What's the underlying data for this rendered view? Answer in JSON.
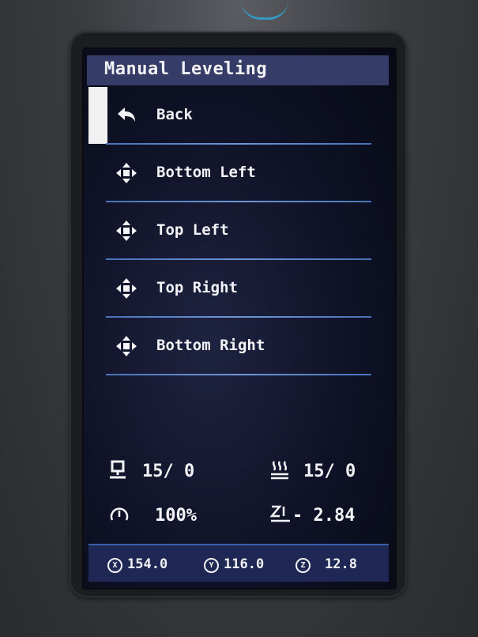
{
  "window": {
    "title": "Manual Leveling"
  },
  "menu": {
    "items": [
      {
        "label": "Back",
        "icon": "back-arrow-icon"
      },
      {
        "label": "Bottom Left",
        "icon": "move-icon"
      },
      {
        "label": "Top Left",
        "icon": "move-icon"
      },
      {
        "label": "Top Right",
        "icon": "move-icon"
      },
      {
        "label": "Bottom Right",
        "icon": "move-icon"
      }
    ],
    "selected_index": 0
  },
  "status": {
    "bed_temp": "15/ 0",
    "nozzle_temp": "15/ 0",
    "speed": "100%",
    "z_offset": "- 2.84"
  },
  "coords": {
    "x_label": "X",
    "x": "154.0",
    "y_label": "Y",
    "y": "116.0",
    "z_label": "Z",
    "z": "12.8"
  },
  "colors": {
    "title_bar": "#363c68",
    "separator": "#5a84c8",
    "bottom_bar": "#1f2754",
    "screen_bg": "#0f1226"
  }
}
